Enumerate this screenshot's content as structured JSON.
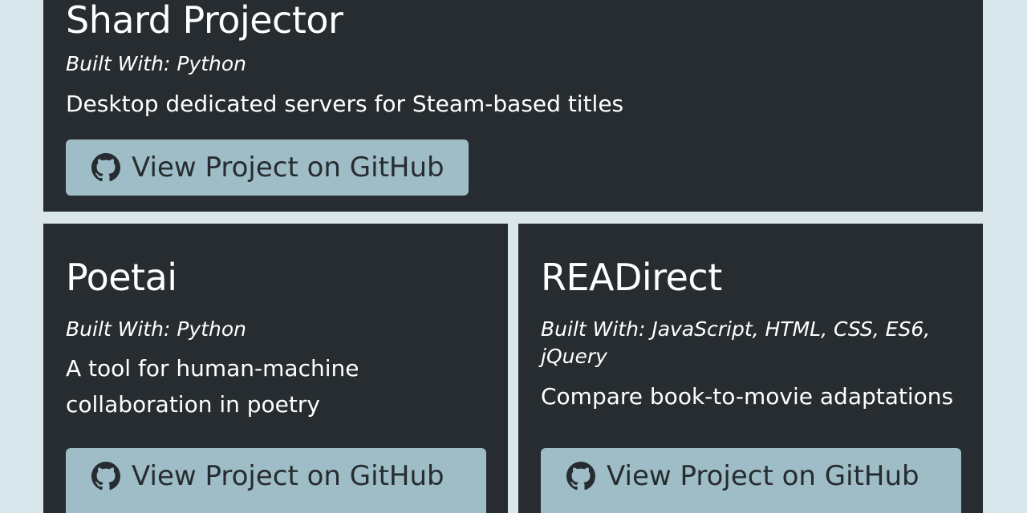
{
  "projects": [
    {
      "title": "Shard Projector",
      "built_with": "Built With: Python",
      "description": "Desktop dedicated servers for Steam-based titles",
      "button_label": "View Project on GitHub",
      "button_icon": "github-icon"
    },
    {
      "title": "Poetai",
      "built_with": "Built With: Python",
      "description": "A tool for human-machine collaboration in poetry",
      "button_label": "View Project on GitHub",
      "button_icon": "github-icon"
    },
    {
      "title": "READirect",
      "built_with": "Built With: JavaScript, HTML, CSS, ES6, jQuery",
      "description": "Compare book-to-movie adaptations",
      "button_label": "View Project on GitHub",
      "button_icon": "github-icon"
    }
  ],
  "colors": {
    "background": "#d9e6ec",
    "card": "#262c30",
    "button": "#9ebdc6",
    "button_text": "#262c30",
    "text": "#ffffff"
  }
}
